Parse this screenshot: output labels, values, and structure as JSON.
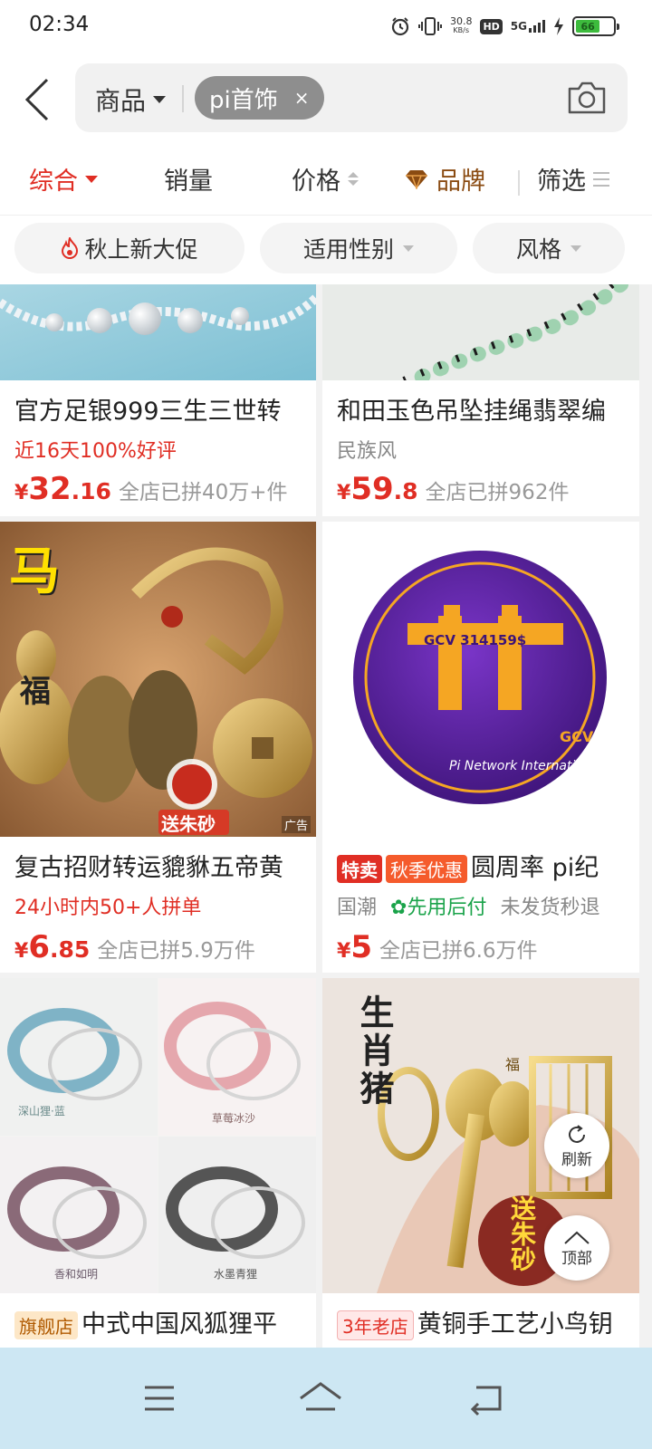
{
  "status_bar": {
    "time": "02:34",
    "net_speed_value": "30.8",
    "net_speed_unit": "KB/s",
    "hd_label": "HD",
    "network_label": "5G",
    "battery_percent": "66"
  },
  "search": {
    "scope_label": "商品",
    "chip_text": "pi首饰",
    "chip_clear": "×"
  },
  "sort_tabs": [
    {
      "label": "综合"
    },
    {
      "label": "销量"
    },
    {
      "label": "价格"
    },
    {
      "label": "品牌"
    },
    {
      "label": "筛选"
    }
  ],
  "quick_filters": [
    {
      "label": "秋上新大促"
    },
    {
      "label": "适用性别"
    },
    {
      "label": "风格"
    }
  ],
  "products": [
    {
      "title": "官方足银999三生三世转",
      "subtitle": "近16天100%好评",
      "price_currency": "¥",
      "price_int": "32",
      "price_dec": ".16",
      "sold": "全店已拼40万+件"
    },
    {
      "title": "和田玉色吊坠挂绳翡翠编",
      "subtitle": "民族风",
      "price_currency": "¥",
      "price_int": "59",
      "price_dec": ".8",
      "sold": "全店已拼962件"
    },
    {
      "title": "复古招财转运貔貅五帝黄",
      "subtitle": "24小时内50+人拼单",
      "price_currency": "¥",
      "price_int": "6",
      "price_dec": ".85",
      "sold": "全店已拼5.9万件",
      "image_text_top": "马",
      "image_text_left": "福",
      "image_text_badge": "送朱砂",
      "ad_label": "广告"
    },
    {
      "tag_hot": "特卖",
      "tag_autumn": "秋季优惠",
      "title": "圆周率 pi纪",
      "subtitle_style": "国潮",
      "subtitle_paylater": "先用后付",
      "subtitle_shipping": "未发货秒退",
      "price_currency": "¥",
      "price_int": "5",
      "price_dec": "",
      "sold": "全店已拼6.6万件",
      "image_text_code": "GCV 314159$",
      "image_text_arc": "Pi Network International",
      "image_text_gcv": "GCV"
    },
    {
      "tag": "旗舰店",
      "title": "中式中国风狐狸平",
      "image_captions": [
        "深山狸·蓝",
        "草莓冰沙",
        "香和如明",
        "水墨青狸"
      ]
    },
    {
      "tag": "3年老店",
      "title": "黄铜手工艺小鸟钥",
      "image_text_side": "生肖猪",
      "image_text_badge": "送朱砂",
      "image_text_tag": "福"
    }
  ],
  "float_buttons": {
    "refresh": "刷新",
    "top": "顶部"
  },
  "colors": {
    "accent_red": "#e02e24",
    "nav_bar": "#cde7f3",
    "feed_bg": "#f2f2f2",
    "paylater_green": "#1aa34a"
  },
  "icons": [
    "alarm-icon",
    "vibrate-icon",
    "signal-icon",
    "battery-icon",
    "back-icon",
    "camera-icon",
    "diamond-icon",
    "fire-icon",
    "menu-icon",
    "home-icon",
    "return-icon",
    "refresh-icon",
    "arrow-up-icon"
  ]
}
